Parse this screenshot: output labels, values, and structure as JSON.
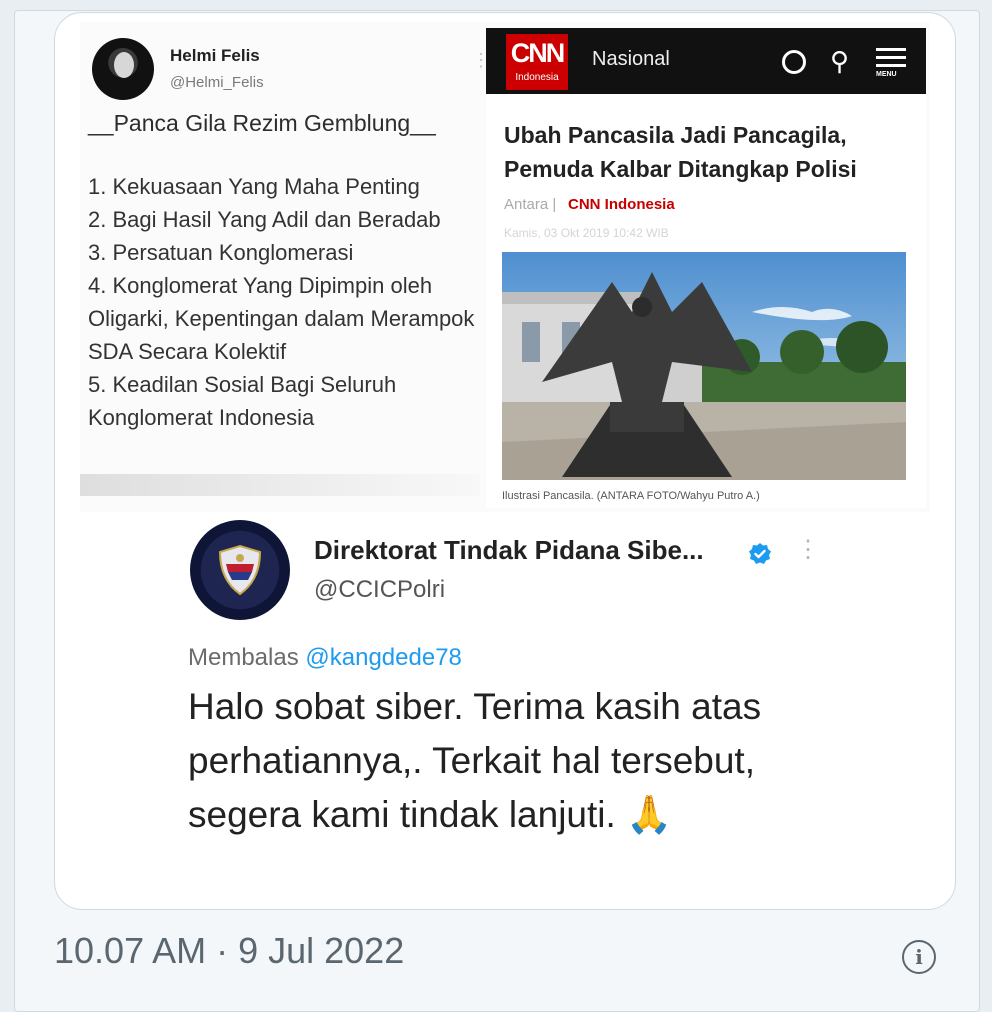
{
  "embed": {
    "left_tweet": {
      "name": "Helmi Felis",
      "handle": "@Helmi_Felis",
      "title": "__Panca Gila Rezim Gemblung__",
      "items": [
        "1. Kekuasaan Yang Maha Penting",
        "2. Bagi Hasil Yang Adil dan Beradab",
        "3. Persatuan Konglomerasi",
        "4. Konglomerat Yang Dipimpin oleh Oligarki, Kepentingan dalam Merampok SDA Secara Kolektif",
        "5. Keadilan Sosial Bagi Seluruh Konglomerat Indonesia"
      ]
    },
    "cnn": {
      "logo": "CNN",
      "logo_sub": "Indonesia",
      "section": "Nasional",
      "menu_label": "MENU",
      "headline": "Ubah Pancasila Jadi Pancagila, Pemuda Kalbar Ditangkap Polisi",
      "source_prefix": "Antara |",
      "source": "CNN Indonesia",
      "date": "Kamis, 03 Okt 2019 10:42 WIB",
      "caption": "Ilustrasi Pancasila. (ANTARA FOTO/Wahyu Putro A.)",
      "accent": "#cc0000"
    }
  },
  "quoted": {
    "name": "Direktorat Tindak Pidana Sibe...",
    "handle": "@CCICPolri",
    "reply_prefix": "Membalas",
    "reply_to": "@kangdede78",
    "body": "Halo sobat siber. Terima kasih atas perhatiannya,. Terkait hal tersebut, segera kami tindak lanjuti. 🙏",
    "verified_color": "#1d9bf0"
  },
  "footer": {
    "timestamp": "10.07 AM · 9 Jul 2022"
  },
  "icons": [
    "more-icon",
    "user-icon",
    "search-icon",
    "menu-icon",
    "verified-badge-icon",
    "info-icon",
    "pray-emoji"
  ]
}
